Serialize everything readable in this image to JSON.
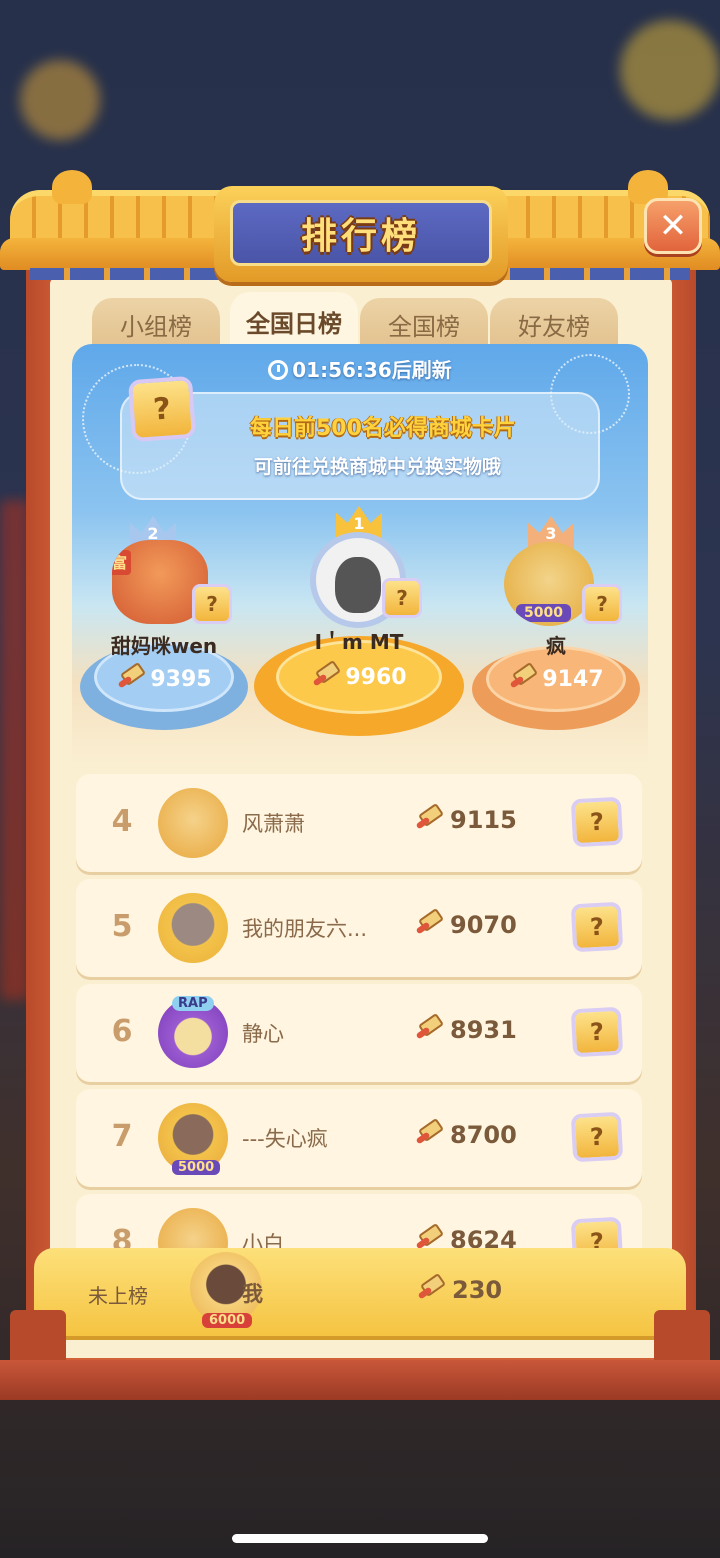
{
  "header": {
    "title": "排行榜",
    "close_glyph": "✕"
  },
  "tabs": [
    {
      "label": "小组榜",
      "active": false
    },
    {
      "label": "全国日榜",
      "active": true
    },
    {
      "label": "全国榜",
      "active": false
    },
    {
      "label": "好友榜",
      "active": false
    }
  ],
  "timer": {
    "text": "01:56:36后刷新"
  },
  "banner": {
    "card_glyph": "?",
    "line1": "每日前500名必得商城卡片",
    "line2": "可前往兑换商城中兑换实物哦"
  },
  "podium": {
    "first": {
      "rank": "1",
      "name": "I＇m MT",
      "score": "9960"
    },
    "second": {
      "rank": "2",
      "name": "甜妈咪wen",
      "score": "9395",
      "badge": "富"
    },
    "third": {
      "rank": "3",
      "name": "疯",
      "score": "9147",
      "badge": "5000"
    }
  },
  "rows": [
    {
      "rank": "4",
      "name": "风萧萧",
      "score": "9115"
    },
    {
      "rank": "5",
      "name": "我的朋友六...",
      "score": "9070"
    },
    {
      "rank": "6",
      "name": "静心",
      "score": "8931",
      "badge": "RAP"
    },
    {
      "rank": "7",
      "name": "---失心疯",
      "score": "8700",
      "badge": "5000"
    },
    {
      "rank": "8",
      "name": "小白",
      "score": "8624"
    }
  ],
  "my_row": {
    "label": "未上榜",
    "name": "我",
    "score": "230",
    "badge": "6000"
  },
  "card_glyph": "?",
  "colors": {
    "accent": "#f5c442",
    "frame": "#d2613a",
    "plaque": "#4a55a8",
    "panel": "#fbefd2"
  }
}
